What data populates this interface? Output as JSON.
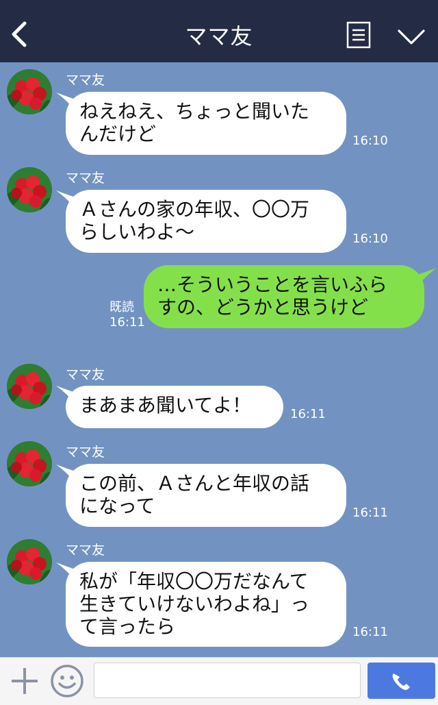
{
  "header": {
    "title": "ママ友"
  },
  "messages": [
    {
      "side": "in",
      "sender": "ママ友",
      "lines": [
        "ねえねえ、ちょっと聞いた",
        "んだけど"
      ],
      "time": "16:10"
    },
    {
      "side": "in",
      "sender": "ママ友",
      "lines": [
        "Ａさんの家の年収、〇〇万",
        "らしいわよ〜"
      ],
      "time": "16:10"
    },
    {
      "side": "out",
      "lines": [
        "…そういうことを言いふら",
        "すの、どうかと思うけど"
      ],
      "read": "既読",
      "time": "16:11"
    },
    {
      "side": "in",
      "sender": "ママ友",
      "lines": [
        "まあまあ聞いてよ！"
      ],
      "time": "16:11"
    },
    {
      "side": "in",
      "sender": "ママ友",
      "lines": [
        "この前、Ａさんと年収の話",
        "になって"
      ],
      "time": "16:11"
    },
    {
      "side": "in",
      "sender": "ママ友",
      "lines": [
        "私が「年収〇〇万だなんて",
        "生きていけないわよね」っ",
        "て言ったら"
      ],
      "time": "16:11"
    }
  ],
  "footer": {
    "input_value": ""
  },
  "colors": {
    "header": "#232c44",
    "background": "#7293c1",
    "outgoing_bubble": "#84e04a",
    "send_button": "#4c79e0"
  },
  "icons": [
    "back-arrow-icon",
    "menu-list-icon",
    "chevron-down-icon",
    "avatar-cherry-image",
    "plus-icon",
    "smiley-icon",
    "phone-icon"
  ]
}
